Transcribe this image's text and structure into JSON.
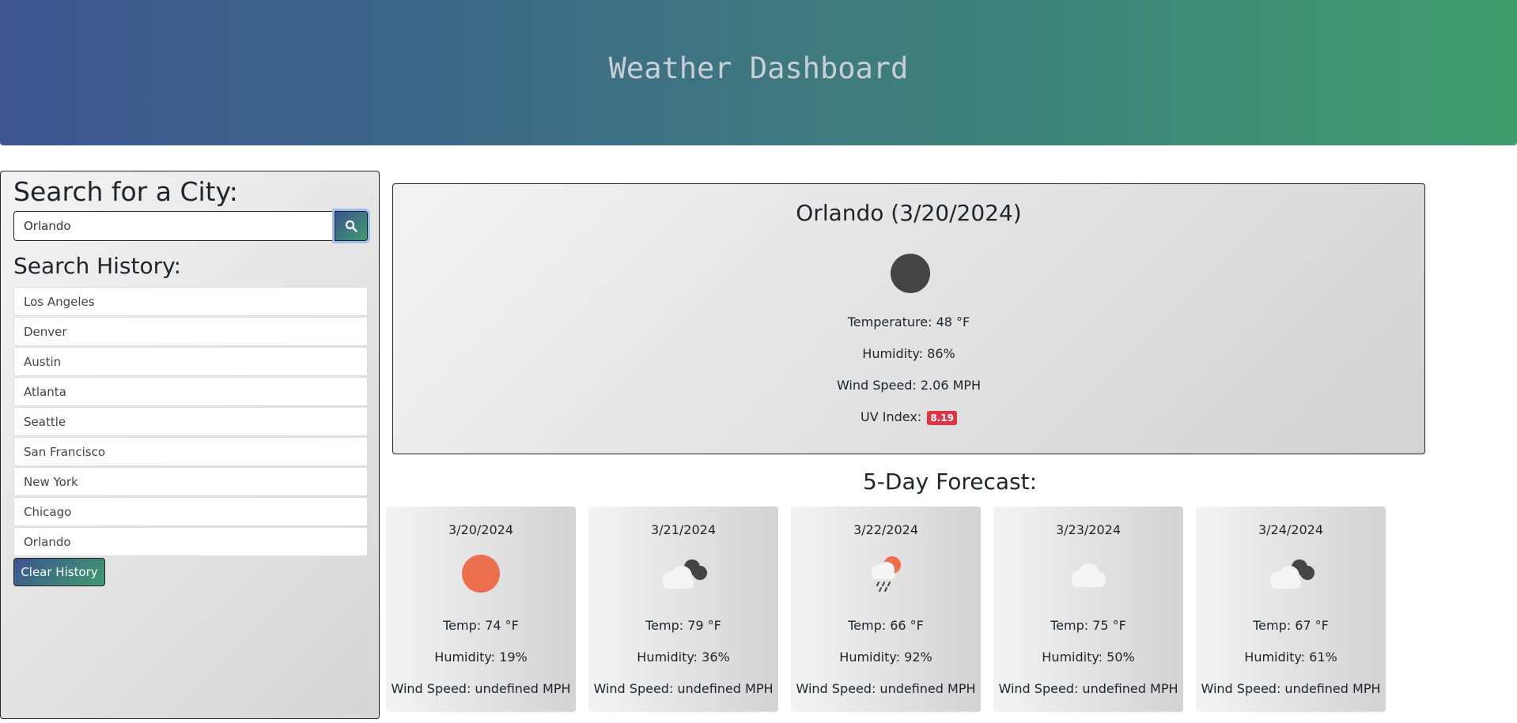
{
  "header": {
    "title": "Weather Dashboard"
  },
  "sidebar": {
    "search_title": "Search for a City:",
    "search_value": "Orlando",
    "search_icon": "search-icon",
    "history_title": "Search History:",
    "history": [
      "Los Angeles",
      "Denver",
      "Austin",
      "Atlanta",
      "Seattle",
      "San Francisco",
      "New York",
      "Chicago",
      "Orlando"
    ],
    "clear_label": "Clear History"
  },
  "current": {
    "title": "Orlando (3/20/2024)",
    "icon": "dark-circle-icon",
    "temperature": "Temperature: 48 °F",
    "humidity": "Humidity: 86%",
    "wind": "Wind Speed: 2.06 MPH",
    "uv_label": "UV Index:",
    "uv_value": "8.19",
    "uv_color": "#dc3545"
  },
  "forecast": {
    "title": "5-Day Forecast:",
    "days": [
      {
        "date": "3/20/2024",
        "icon": "sun-icon",
        "temp": "Temp: 74 °F",
        "humidity": "Humidity: 19%",
        "wind": "Wind Speed: undefined MPH"
      },
      {
        "date": "3/21/2024",
        "icon": "cloudy-icon",
        "temp": "Temp: 79 °F",
        "humidity": "Humidity: 36%",
        "wind": "Wind Speed: undefined MPH"
      },
      {
        "date": "3/22/2024",
        "icon": "rain-sun-icon",
        "temp": "Temp: 66 °F",
        "humidity": "Humidity: 92%",
        "wind": "Wind Speed: undefined MPH"
      },
      {
        "date": "3/23/2024",
        "icon": "cloud-icon",
        "temp": "Temp: 75 °F",
        "humidity": "Humidity: 50%",
        "wind": "Wind Speed: undefined MPH"
      },
      {
        "date": "3/24/2024",
        "icon": "cloudy-icon",
        "temp": "Temp: 67 °F",
        "humidity": "Humidity: 61%",
        "wind": "Wind Speed: undefined MPH"
      }
    ]
  },
  "colors": {
    "header_start": "#3d5490",
    "header_end": "#3f9b6e",
    "sun": "#ec6e4c",
    "dark_cloud": "#444444",
    "light_cloud": "#f5f5f5"
  }
}
